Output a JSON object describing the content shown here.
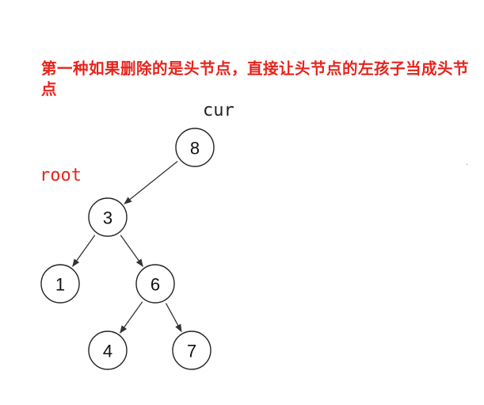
{
  "caption": "第一种如果删除的是头节点，直接让头节点的左孩子当成头节点",
  "labels": {
    "cur": "cur",
    "root": "root"
  },
  "stray_mark": ".",
  "colors": {
    "caption": "#e8231c",
    "root_label": "#e8231c",
    "cur_label": "#222222",
    "node_stroke": "#222222"
  },
  "tree": {
    "nodes": [
      {
        "id": "n8",
        "value": "8"
      },
      {
        "id": "n3",
        "value": "3"
      },
      {
        "id": "n1",
        "value": "1"
      },
      {
        "id": "n6",
        "value": "6"
      },
      {
        "id": "n4",
        "value": "4"
      },
      {
        "id": "n7",
        "value": "7"
      }
    ],
    "edges": [
      {
        "from": "n8",
        "to": "n3"
      },
      {
        "from": "n3",
        "to": "n1"
      },
      {
        "from": "n3",
        "to": "n6"
      },
      {
        "from": "n6",
        "to": "n4"
      },
      {
        "from": "n6",
        "to": "n7"
      }
    ]
  }
}
